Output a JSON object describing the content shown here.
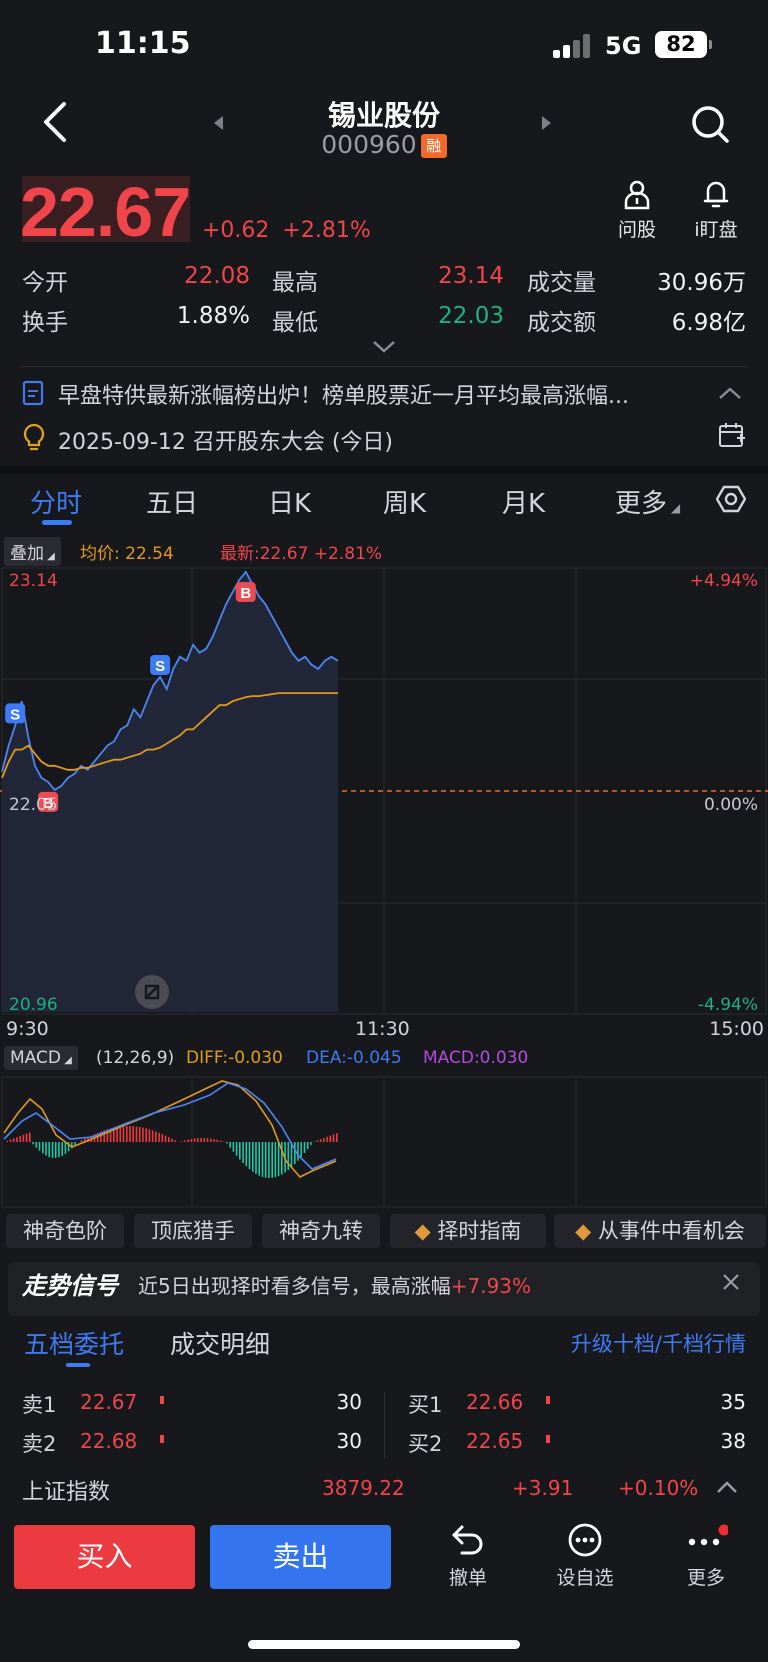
{
  "status_bar": {
    "time": "11:15",
    "network": "5G",
    "battery": "82"
  },
  "header": {
    "name": "锡业股份",
    "code": "000960",
    "margin_badge": "融"
  },
  "quote": {
    "price": "22.67",
    "change": "+0.62",
    "change_pct": "+2.81%",
    "ask_label": "问股",
    "watch_label": "i盯盘"
  },
  "stats": [
    {
      "label": "今开",
      "value": "22.08",
      "color": "red"
    },
    {
      "label": "最高",
      "value": "23.14",
      "color": "red"
    },
    {
      "label": "成交量",
      "value": "30.96万",
      "color": "white"
    },
    {
      "label": "换手",
      "value": "1.88%",
      "color": "white"
    },
    {
      "label": "最低",
      "value": "22.03",
      "color": "green"
    },
    {
      "label": "成交额",
      "value": "6.98亿",
      "color": "white"
    }
  ],
  "news": [
    {
      "text": "早盘特供最新涨幅榜出炉！榜单股票近一月平均最高涨幅...",
      "icon": "document-icon"
    },
    {
      "text": "2025-09-12 召开股东大会 (今日)",
      "icon": "lightbulb-icon"
    }
  ],
  "chart_tabs": [
    "分时",
    "五日",
    "日K",
    "周K",
    "月K",
    "更多"
  ],
  "chart_legend": {
    "overlay": "叠加",
    "avg": "均价: 22.54",
    "latest": "最新:22.67 +2.81%"
  },
  "chart_data": {
    "type": "line",
    "y_left_ticks": [
      "23.14",
      "22.05",
      "20.96"
    ],
    "y_right_ticks": [
      "+4.94%",
      "0.00%",
      "-4.94%"
    ],
    "x_ticks": [
      "9:30",
      "11:30",
      "15:00"
    ],
    "ylim": [
      20.96,
      23.14
    ],
    "prev_close": 22.05,
    "series": [
      {
        "values": [
          22.15,
          22.28,
          22.38,
          22.5,
          22.32,
          22.18,
          22.12,
          22.1,
          22.06,
          22.08,
          22.12,
          22.14,
          22.18,
          22.16,
          22.2,
          22.24,
          22.28,
          22.3,
          22.36,
          22.38,
          22.46,
          22.42,
          22.5,
          22.58,
          22.62,
          22.56,
          22.66,
          22.72,
          22.7,
          22.78,
          22.74,
          22.76,
          22.82,
          22.9,
          22.98,
          23.04,
          23.1,
          23.14,
          23.08,
          23.02,
          22.98,
          22.92,
          22.86,
          22.8,
          22.74,
          22.7,
          22.72,
          22.68,
          22.66,
          22.7,
          22.72,
          22.7
        ]
      },
      {
        "values": [
          22.12,
          22.2,
          22.26,
          22.28,
          22.24,
          22.2,
          22.18,
          22.17,
          22.16,
          22.16,
          22.17,
          22.18,
          22.19,
          22.2,
          22.21,
          22.22,
          22.23,
          22.24,
          22.26,
          22.27,
          22.29,
          22.31,
          22.33,
          22.36,
          22.39,
          22.42,
          22.45,
          22.48,
          22.5,
          22.51,
          22.52,
          22.525,
          22.53,
          22.535,
          22.54,
          22.54,
          22.54,
          22.54,
          22.54,
          22.54,
          22.54,
          22.54
        ]
      }
    ],
    "markers": [
      {
        "label": "S",
        "index": 2
      },
      {
        "label": "B",
        "index": 7
      },
      {
        "label": "S",
        "index": 24
      },
      {
        "label": "B",
        "index": 37
      }
    ]
  },
  "macd": {
    "label": "MACD",
    "params": "(12,26,9)",
    "diff": "DIFF:-0.030",
    "dea": "DEA:-0.045",
    "macd": "MACD:0.030"
  },
  "feature_chips": [
    "神奇色阶",
    "顶底猎手",
    "神奇九转",
    "择时指南",
    "从事件中看机会"
  ],
  "signal": {
    "title": "走势信号",
    "text": "近5日出现择时看多信号，最高涨幅",
    "pct": "+7.93%"
  },
  "orderbook": {
    "tab_active": "五档委托",
    "tab_other": "成交明细",
    "upgrade": "升级十档/千档行情",
    "sell": [
      {
        "label": "卖1",
        "price": "22.67",
        "qty": "30"
      },
      {
        "label": "卖2",
        "price": "22.68",
        "qty": "30"
      }
    ],
    "buy": [
      {
        "label": "买1",
        "price": "22.66",
        "qty": "35"
      },
      {
        "label": "买2",
        "price": "22.65",
        "qty": "38"
      }
    ]
  },
  "index_ticker": {
    "name": "上证指数",
    "value": "3879.22",
    "change": "+3.91",
    "pct": "+0.10%"
  },
  "actions": {
    "buy": "买入",
    "sell": "卖出",
    "cancel": "撤单",
    "watchlist": "设自选",
    "more": "更多"
  },
  "colors": {
    "up": "#f0454b",
    "down": "#1fb07d",
    "accent": "#3d7af3",
    "avg_line": "#e09a1e"
  }
}
